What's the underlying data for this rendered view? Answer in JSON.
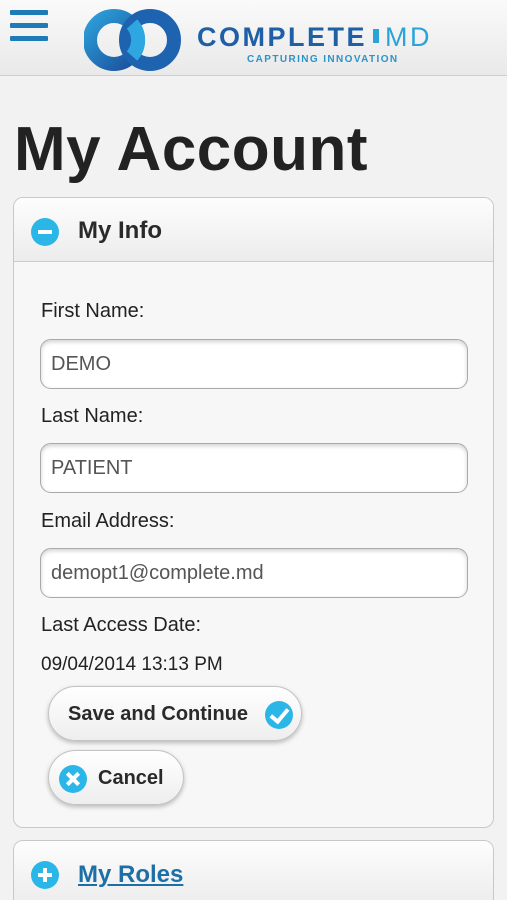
{
  "header": {
    "menu_icon": "hamburger-menu-icon",
    "logo": {
      "brand_main": "COMPLETE",
      "brand_md": "MD",
      "tagline": "CAPTURING INNOVATION"
    }
  },
  "page": {
    "title": "My Account"
  },
  "my_info": {
    "title": "My Info",
    "toggle_icon": "minus-circle-icon",
    "fields": {
      "first_name": {
        "label": "First Name:",
        "value": "DEMO"
      },
      "last_name": {
        "label": "Last Name:",
        "value": "PATIENT"
      },
      "email": {
        "label": "Email Address:",
        "value": "demopt1@complete.md"
      },
      "last_access": {
        "label": "Last Access Date:",
        "value": "09/04/2014 13:13 PM"
      }
    },
    "buttons": {
      "save": {
        "label": "Save and Continue",
        "icon": "check-circle-icon"
      },
      "cancel": {
        "label": "Cancel",
        "icon": "x-circle-icon"
      }
    }
  },
  "my_roles": {
    "title": "My Roles",
    "toggle_icon": "plus-circle-icon"
  },
  "colors": {
    "accent": "#2bb6e8",
    "brand_blue": "#1f5fa6",
    "link": "#1d6fa5"
  }
}
